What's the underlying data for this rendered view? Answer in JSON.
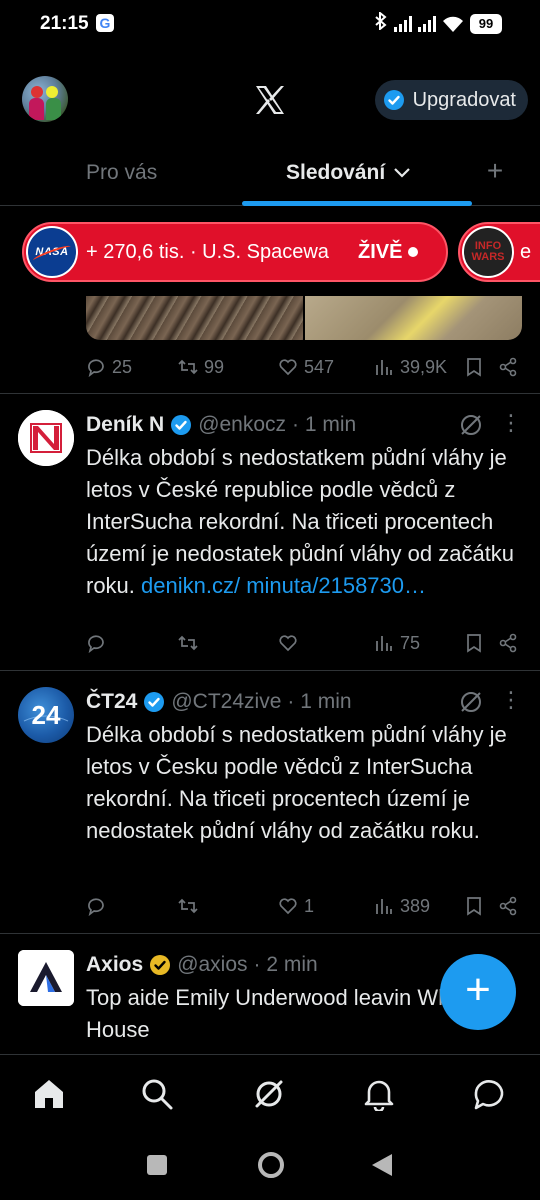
{
  "status_bar": {
    "time": "21:15",
    "google_badge": "G",
    "battery": "99"
  },
  "header": {
    "upgrade_label": "Upgradovat"
  },
  "tabs": [
    {
      "label": "Pro vás",
      "active": false
    },
    {
      "label": "Sledování",
      "active": true
    }
  ],
  "tab_add_label": "+",
  "live": {
    "primary": {
      "badge": "NASA",
      "text": "+ 270,6 tis. · U.S. Spacewa",
      "live_label": "ŽIVĚ"
    },
    "secondary": {
      "badge_line1": "INFO",
      "badge_line2": "WARS",
      "text": "e"
    }
  },
  "prev_post": {
    "replies": "25",
    "reposts": "99",
    "likes": "547",
    "views": "39,9K"
  },
  "tweets": [
    {
      "name": "Deník N",
      "handle": "@enkocz",
      "time": "· 1 min",
      "text": "Délka období s nedostatkem půdní vláhy je letos v České republice podle vědců z InterSucha rekordní. Na třiceti procentech území je nedostatek půdní vláhy od začátku roku.",
      "link": "denikn.cz/ minuta/2158730…",
      "replies": "",
      "reposts": "",
      "likes": "",
      "views": "75",
      "avatar_letter": "N"
    },
    {
      "name": "ČT24",
      "handle": "@CT24zive",
      "time": "· 1 min",
      "text": "Délka období s nedostatkem půdní vláhy je letos v Česku podle vědců z InterSucha rekordní. Na třiceti procentech území je nedostatek půdní vláhy od začátku roku.",
      "replies": "",
      "reposts": "",
      "likes": "1",
      "views": "389",
      "avatar_label": "24"
    },
    {
      "name": "Axios",
      "handle": "@axios",
      "time": "· 2 min",
      "text": "Top aide Emily Underwood leavin White House",
      "avatar_letter": "A"
    }
  ],
  "fab_label": "+",
  "colors": {
    "accent": "#1d9bf0",
    "live": "#e0102a",
    "muted": "#71767b",
    "gold": "#e8b925"
  },
  "icons": [
    "home-icon",
    "search-icon",
    "grok-icon",
    "bell-icon",
    "messages-icon"
  ]
}
